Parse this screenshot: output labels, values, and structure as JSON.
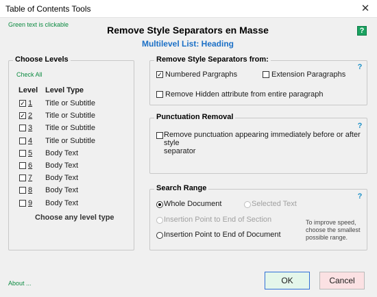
{
  "window": {
    "title": "Table of Contents Tools",
    "close_glyph": "✕"
  },
  "hint_text": "Green text is clickable",
  "heading": "Remove Style Separators en Masse",
  "subheading": "Multilevel List:  Heading",
  "help_glyph": "?",
  "choose_levels": {
    "legend": "Choose Levels",
    "check_all": "Check All",
    "col_level": "Level",
    "col_type": "Level Type",
    "rows": [
      {
        "num": "1",
        "type": "Title or Subtitle",
        "checked": true
      },
      {
        "num": "2",
        "type": "Title or Subtitle",
        "checked": true
      },
      {
        "num": "3",
        "type": "Title or Subtitle",
        "checked": false
      },
      {
        "num": "4",
        "type": "Title or Subtitle",
        "checked": false
      },
      {
        "num": "5",
        "type": "Body Text",
        "checked": false
      },
      {
        "num": "6",
        "type": "Body Text",
        "checked": false
      },
      {
        "num": "7",
        "type": "Body Text",
        "checked": false
      },
      {
        "num": "8",
        "type": "Body Text",
        "checked": false
      },
      {
        "num": "9",
        "type": "Body Text",
        "checked": false
      }
    ],
    "footer": "Choose any level type"
  },
  "remove_from": {
    "legend": "Remove Style Separators from:",
    "numbered_label": "Numbered Pargraphs",
    "numbered_checked": true,
    "extension_label": "Extension Paragraphs",
    "extension_checked": false,
    "hidden_label": "Remove Hidden attribute from entire paragraph",
    "hidden_checked": false
  },
  "punctuation": {
    "legend": "Punctuation Removal",
    "label_line1": "Remove punctuation appearing immediately before or after style",
    "label_line2": "separator",
    "checked": false
  },
  "search_range": {
    "legend": "Search Range",
    "whole_doc": "Whole Document",
    "selected_text": "Selected Text",
    "ip_section": "Insertion Point to End of Section",
    "ip_document": "Insertion Point to End of Document",
    "selected_option": "Whole Document",
    "tip_line1": "To improve speed,",
    "tip_line2": "choose the smallest",
    "tip_line3": "possible range."
  },
  "about_link": "About ...",
  "buttons": {
    "ok": "OK",
    "cancel": "Cancel"
  }
}
